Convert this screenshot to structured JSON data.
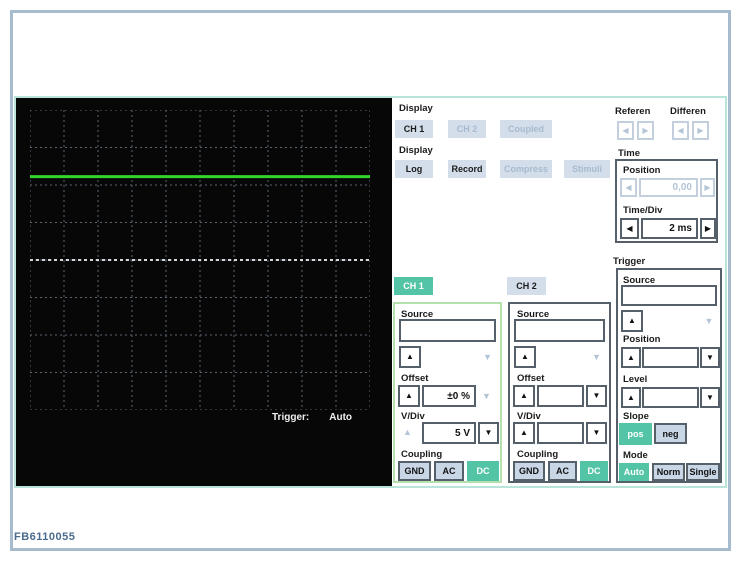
{
  "figure_id": "FB6110055",
  "colors": {
    "accent_teal": "#54c4a7",
    "panel_border_teal": "#b9e4d9",
    "frame_border": "#a7bbce",
    "button_bg": "#d3deea",
    "trace_green": "#35d42c",
    "grid_line": "#59646f"
  },
  "icons": {
    "up": "▲",
    "down": "▼",
    "left": "◀",
    "right": "▶"
  },
  "scope": {
    "grid_cols": 10,
    "grid_rows": 8,
    "trigger_label": "Trigger:",
    "trigger_value": "Auto",
    "traces": [
      {
        "name": "ch1-trace",
        "color": "#35d42c",
        "width": 3,
        "dash": "",
        "y_frac": 0.222
      },
      {
        "name": "reference-baseline",
        "color": "#d2d6d8",
        "width": 2,
        "dash": "3 3",
        "y_frac": 0.5
      }
    ]
  },
  "display_channels": {
    "label": "Display",
    "ch1": "CH 1",
    "ch2": "CH 2",
    "coupled": "Coupled"
  },
  "display_modes": {
    "label": "Display",
    "log": "Log",
    "record": "Record",
    "compress": "Compress",
    "stimuli": "Stimuli"
  },
  "reference": {
    "label": "Referen"
  },
  "differential": {
    "label": "Differen"
  },
  "time": {
    "label": "Time",
    "position_label": "Position",
    "position_value": "0,00",
    "timediv_label": "Time/Div",
    "timediv_value": "2 ms"
  },
  "trigger": {
    "label": "Trigger",
    "source_label": "Source",
    "source_value": "",
    "position_label": "Position",
    "position_value": "",
    "level_label": "Level",
    "level_value": "",
    "slope_label": "Slope",
    "slope_pos": "pos",
    "slope_neg": "neg",
    "mode_label": "Mode",
    "mode_auto": "Auto",
    "mode_norm": "Norm",
    "mode_single": "Single"
  },
  "ch1": {
    "button": "CH 1",
    "source_label": "Source",
    "source_value": "",
    "offset_label": "Offset",
    "offset_value": "±0 %",
    "vdiv_label": "V/Div",
    "vdiv_value": "5 V",
    "coupling_label": "Coupling",
    "gnd": "GND",
    "ac": "AC",
    "dc": "DC"
  },
  "ch2": {
    "button": "CH 2",
    "source_label": "Source",
    "source_value": "",
    "offset_label": "Offset",
    "offset_value": "",
    "vdiv_label": "V/Div",
    "vdiv_value": "",
    "coupling_label": "Coupling",
    "gnd": "GND",
    "ac": "AC",
    "dc": "DC"
  }
}
